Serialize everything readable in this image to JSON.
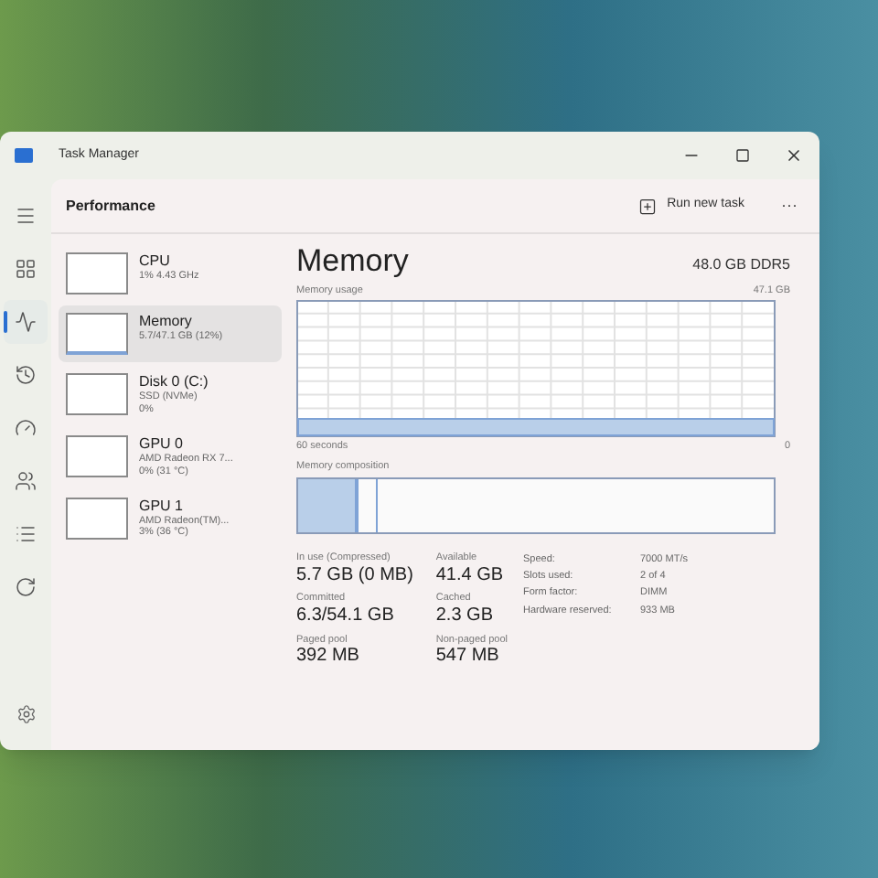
{
  "window": {
    "title": "Task Manager"
  },
  "nav_items": [
    {
      "kind": "menu",
      "selected": false
    },
    {
      "kind": "processes",
      "selected": false
    },
    {
      "kind": "performance",
      "selected": true
    },
    {
      "kind": "history",
      "selected": false
    },
    {
      "kind": "startup",
      "selected": false
    },
    {
      "kind": "users",
      "selected": false
    },
    {
      "kind": "details",
      "selected": false
    },
    {
      "kind": "services",
      "selected": false
    }
  ],
  "header": {
    "title": "Performance",
    "run_new_task": "Run new task",
    "more": "···"
  },
  "devices": [
    {
      "name": "CPU",
      "lines": [
        "1% 4.43 GHz"
      ],
      "selected": false
    },
    {
      "name": "Memory",
      "lines": [
        "5.7/47.1 GB (12%)"
      ],
      "selected": true
    },
    {
      "name": "Disk 0 (C:)",
      "lines": [
        "SSD (NVMe)",
        "0%"
      ],
      "selected": false
    },
    {
      "name": "GPU 0",
      "lines": [
        "AMD Radeon RX 7...",
        "0% (31 °C)"
      ],
      "selected": false
    },
    {
      "name": "GPU 1",
      "lines": [
        "AMD Radeon(TM)...",
        "3% (36 °C)"
      ],
      "selected": false
    }
  ],
  "detail": {
    "title": "Memory",
    "total": "48.0 GB DDR5",
    "usage_label": "Memory usage",
    "usage_max": "47.1 GB",
    "time_label": "60 seconds",
    "time_end": "0",
    "composition_label": "Memory composition",
    "stats": [
      {
        "label": "In use (Compressed)",
        "value": "5.7 GB (0 MB)"
      },
      {
        "label": "Available",
        "value": "41.4 GB"
      },
      {
        "label": "Committed",
        "value": "6.3/54.1 GB"
      },
      {
        "label": "Cached",
        "value": "2.3 GB"
      },
      {
        "label": "Paged pool",
        "value": "392 MB"
      },
      {
        "label": "Non-paged pool",
        "value": "547 MB"
      }
    ],
    "specs": [
      {
        "label": "Speed:",
        "value": "7000 MT/s"
      },
      {
        "label": "Slots used:",
        "value": "2 of 4"
      },
      {
        "label": "Form factor:",
        "value": "DIMM"
      },
      {
        "label": "Hardware reserved:",
        "value": "933 MB"
      }
    ]
  }
}
